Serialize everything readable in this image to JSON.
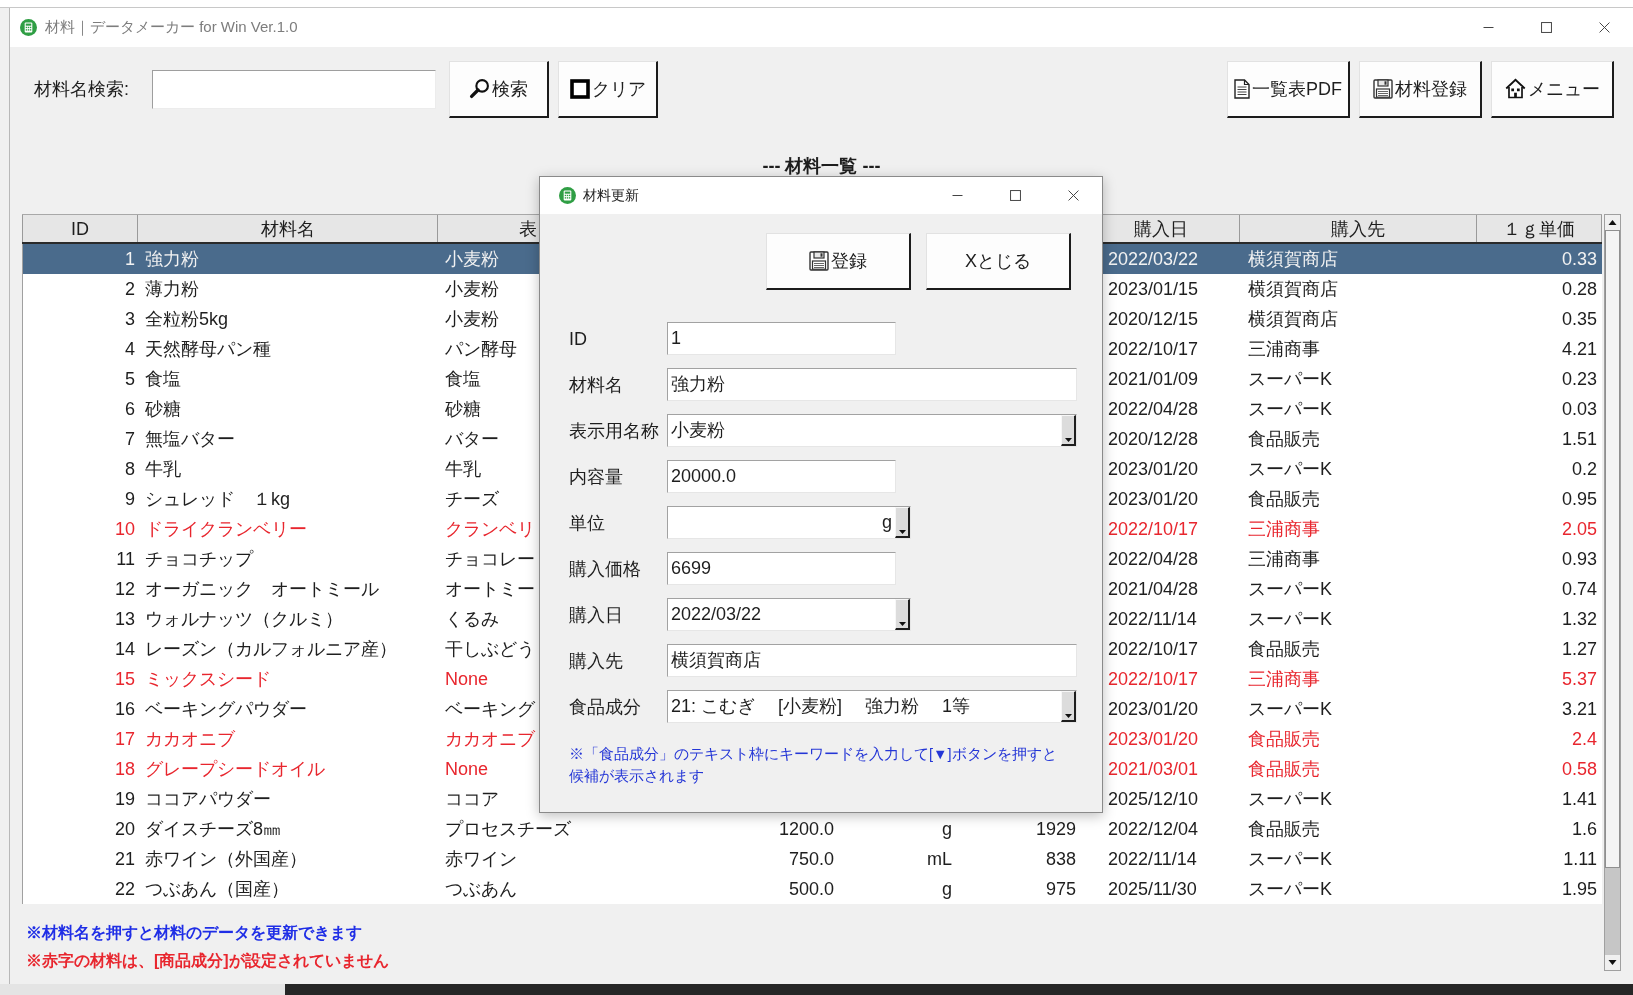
{
  "window": {
    "title": "材料｜データメーカー for Win Ver.1.0"
  },
  "search": {
    "label": "材料名検索:"
  },
  "toolbar_left": [
    {
      "kind": "search",
      "label": "検索"
    },
    {
      "kind": "clear",
      "label": "クリア"
    }
  ],
  "toolbar_right": [
    {
      "kind": "document",
      "label": "一覧表PDF"
    },
    {
      "kind": "save",
      "label": "材料登録"
    },
    {
      "kind": "home",
      "label": "メニュー"
    }
  ],
  "list_title": "--- 材料一覧 ---",
  "table": {
    "columns": [
      "ID",
      "材料名",
      "表",
      "購入日",
      "購入先",
      "１ｇ単価"
    ],
    "rows": [
      {
        "id": "1",
        "name": "強力粉",
        "column_3": "小麦粉",
        "date": "2022/03/22",
        "supplier": "横須賀商店",
        "unit_price": "0.33",
        "selected": true,
        "component_missing": false
      },
      {
        "id": "2",
        "name": "薄力粉",
        "column_3": "小麦粉",
        "date": "2023/01/15",
        "supplier": "横須賀商店",
        "unit_price": "0.28",
        "selected": false,
        "component_missing": false
      },
      {
        "id": "3",
        "name": "全粒粉5kg",
        "column_3": "小麦粉",
        "date": "2020/12/15",
        "supplier": "横須賀商店",
        "unit_price": "0.35",
        "selected": false,
        "component_missing": false
      },
      {
        "id": "4",
        "name": "天然酵母パン種",
        "column_3": "パン酵母",
        "date": "2022/10/17",
        "supplier": "三浦商事",
        "unit_price": "4.21",
        "selected": false,
        "component_missing": false
      },
      {
        "id": "5",
        "name": "食塩",
        "column_3": "食塩",
        "date": "2021/01/09",
        "supplier": "スーパーK",
        "unit_price": "0.23",
        "selected": false,
        "component_missing": false
      },
      {
        "id": "6",
        "name": "砂糖",
        "column_3": "砂糖",
        "date": "2022/04/28",
        "supplier": "スーパーK",
        "unit_price": "0.03",
        "selected": false,
        "component_missing": false
      },
      {
        "id": "7",
        "name": "無塩バター",
        "column_3": "バター",
        "date": "2020/12/28",
        "supplier": "食品販売",
        "unit_price": "1.51",
        "selected": false,
        "component_missing": false
      },
      {
        "id": "8",
        "name": "牛乳",
        "column_3": "牛乳",
        "date": "2023/01/20",
        "supplier": "スーパーK",
        "unit_price": "0.2",
        "selected": false,
        "component_missing": false
      },
      {
        "id": "9",
        "name": "シュレッド　１kg",
        "column_3": "チーズ",
        "date": "2023/01/20",
        "supplier": "食品販売",
        "unit_price": "0.95",
        "selected": false,
        "component_missing": false
      },
      {
        "id": "10",
        "name": "ドライクランベリー",
        "column_3": "クランベリ",
        "date": "2022/10/17",
        "supplier": "三浦商事",
        "unit_price": "2.05",
        "selected": false,
        "component_missing": true
      },
      {
        "id": "11",
        "name": "チョコチップ",
        "column_3": "チョコレー",
        "date": "2022/04/28",
        "supplier": "三浦商事",
        "unit_price": "0.93",
        "selected": false,
        "component_missing": false
      },
      {
        "id": "12",
        "name": "オーガニック　オートミール",
        "column_3": "オートミー",
        "date": "2021/04/28",
        "supplier": "スーパーK",
        "unit_price": "0.74",
        "selected": false,
        "component_missing": false
      },
      {
        "id": "13",
        "name": "ウォルナッツ（クルミ）",
        "column_3": "くるみ",
        "date": "2022/11/14",
        "supplier": "スーパーK",
        "unit_price": "1.32",
        "selected": false,
        "component_missing": false
      },
      {
        "id": "14",
        "name": "レーズン（カルフォルニア産）",
        "column_3": "干しぶどう",
        "date": "2022/10/17",
        "supplier": "食品販売",
        "unit_price": "1.27",
        "selected": false,
        "component_missing": false
      },
      {
        "id": "15",
        "name": "ミックスシード",
        "column_3": "None",
        "date": "2022/10/17",
        "supplier": "三浦商事",
        "unit_price": "5.37",
        "selected": false,
        "component_missing": true
      },
      {
        "id": "16",
        "name": "ベーキングパウダー",
        "column_3": "ベーキング",
        "date": "2023/01/20",
        "supplier": "スーパーK",
        "unit_price": "3.21",
        "selected": false,
        "component_missing": false
      },
      {
        "id": "17",
        "name": "カカオニブ",
        "column_3": "カカオニブ",
        "date": "2023/01/20",
        "supplier": "食品販売",
        "unit_price": "2.4",
        "selected": false,
        "component_missing": true
      },
      {
        "id": "18",
        "name": "グレープシードオイル",
        "column_3": "None",
        "date": "2021/03/01",
        "supplier": "食品販売",
        "unit_price": "0.58",
        "selected": false,
        "component_missing": true
      },
      {
        "id": "19",
        "name": "ココアパウダー",
        "column_3": "ココア",
        "date": "2025/12/10",
        "supplier": "スーパーK",
        "unit_price": "1.41",
        "selected": false,
        "component_missing": false
      },
      {
        "id": "20",
        "name": "ダイスチーズ8㎜",
        "column_3": "プロセスチーズ",
        "column_4": "1200.0",
        "column_5": "g",
        "column_6": "1929",
        "date": "2022/12/04",
        "supplier": "食品販売",
        "unit_price": "1.6",
        "selected": false,
        "component_missing": false
      },
      {
        "id": "21",
        "name": "赤ワイン（外国産）",
        "column_3": "赤ワイン",
        "column_4": "750.0",
        "column_5": "mL",
        "column_6": "838",
        "date": "2022/11/14",
        "supplier": "スーパーK",
        "unit_price": "1.11",
        "selected": false,
        "component_missing": false
      },
      {
        "id": "22",
        "name": "つぶあん（国産）",
        "column_3": "つぶあん",
        "column_4": "500.0",
        "column_5": "g",
        "column_6": "975",
        "date": "2025/11/30",
        "supplier": "スーパーK",
        "unit_price": "1.95",
        "selected": false,
        "component_missing": false
      }
    ]
  },
  "notes": [
    {
      "kind": "info",
      "text": "※材料名を押すと材料のデータを更新できます"
    },
    {
      "kind": "warning",
      "text": "※赤字の材料は、[商品成分]が設定されていません"
    }
  ],
  "dialog": {
    "title": "材料更新",
    "buttons": [
      {
        "kind": "save",
        "label": "登録"
      },
      {
        "kind": "close",
        "label": "Xとじる"
      }
    ],
    "fields": [
      {
        "label": "ID",
        "kind": "text",
        "value": "1"
      },
      {
        "label": "材料名",
        "kind": "text",
        "value": "強力粉"
      },
      {
        "label": "表示用名称",
        "kind": "select",
        "value": "小麦粉"
      },
      {
        "label": "内容量",
        "kind": "text",
        "value": "20000.0"
      },
      {
        "label": "単位",
        "kind": "select",
        "value": "g"
      },
      {
        "label": "購入価格",
        "kind": "text",
        "value": "6699"
      },
      {
        "label": "購入日",
        "kind": "select",
        "value": "2022/03/22"
      },
      {
        "label": "購入先",
        "kind": "text",
        "value": "横須賀商店"
      },
      {
        "label": "食品成分",
        "kind": "select",
        "value": "21: こむぎ　 [小麦粉]　 強力粉　 1等"
      }
    ],
    "note": "※「食品成分」のテキスト枠にキーワードを入力して[▼]ボタンを押すと候補が表示されます"
  }
}
